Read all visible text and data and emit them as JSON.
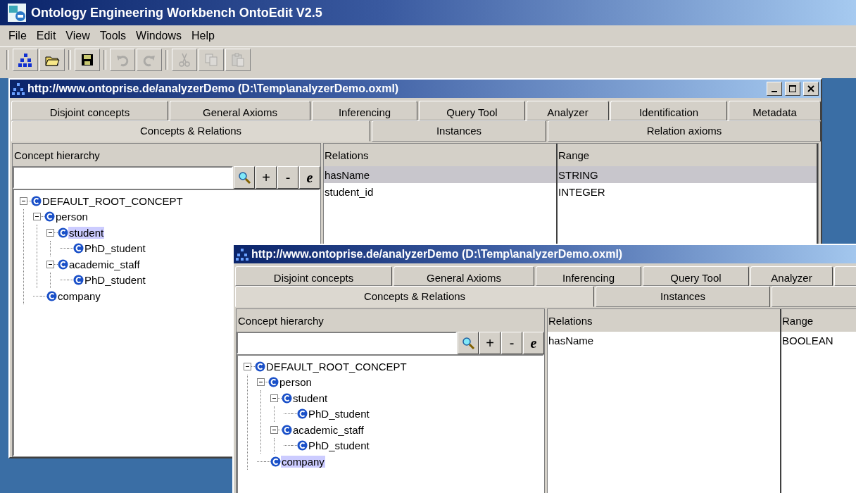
{
  "app": {
    "title": "Ontology Engineering Workbench OntoEdit V2.5",
    "menu": [
      "File",
      "Edit",
      "View",
      "Tools",
      "Windows",
      "Help"
    ],
    "toolbar": [
      {
        "kind": "hierarchy",
        "disabled": false
      },
      {
        "kind": "open",
        "disabled": false
      },
      {
        "kind": "save",
        "disabled": false
      },
      {
        "kind": "undo",
        "disabled": true
      },
      {
        "kind": "redo",
        "disabled": true
      },
      {
        "kind": "cut",
        "disabled": true
      },
      {
        "kind": "copy",
        "disabled": true
      },
      {
        "kind": "paste",
        "disabled": true
      }
    ]
  },
  "windows": [
    {
      "title": "http://www.ontoprise.de/analyzerDemo (D:\\Temp\\analyzerDemo.oxml)",
      "controls": true,
      "tabs_back": [
        {
          "label": "Disjoint concepts",
          "selected": false
        },
        {
          "label": "General Axioms",
          "selected": false
        },
        {
          "label": "Inferencing",
          "selected": false
        },
        {
          "label": "Query Tool",
          "selected": false
        },
        {
          "label": "Analyzer",
          "selected": false
        },
        {
          "label": "Identification",
          "selected": false
        },
        {
          "label": "Metadata",
          "selected": false
        }
      ],
      "tabs_front": [
        {
          "label": "Concepts & Relations",
          "selected": true
        },
        {
          "label": "Instances",
          "selected": false
        },
        {
          "label": "Relation axioms",
          "selected": false
        }
      ],
      "concept_panel": {
        "header": "Concept hierarchy",
        "buttons": [
          "+",
          "-",
          "e"
        ],
        "tree": [
          {
            "label": "DEFAULT_ROOT_CONCEPT",
            "selected": false,
            "expanded": true,
            "children": [
              {
                "label": "person",
                "selected": false,
                "expanded": true,
                "children": [
                  {
                    "label": "student",
                    "selected": true,
                    "expanded": true,
                    "children": [
                      {
                        "label": "PhD_student",
                        "selected": false
                      }
                    ]
                  },
                  {
                    "label": "academic_staff",
                    "selected": false,
                    "expanded": true,
                    "children": [
                      {
                        "label": "PhD_student",
                        "selected": false
                      }
                    ]
                  }
                ]
              },
              {
                "label": "company",
                "selected": false
              }
            ]
          }
        ]
      },
      "relations": {
        "columns": [
          "Relations",
          "Range"
        ],
        "rows": [
          {
            "relation": "hasName",
            "range": "STRING",
            "selected": true
          },
          {
            "relation": "student_id",
            "range": "INTEGER",
            "selected": false
          }
        ]
      }
    },
    {
      "title": "http://www.ontoprise.de/analyzerDemo (D:\\Temp\\analyzerDemo.oxml)",
      "controls": false,
      "tabs_back": [
        {
          "label": "Disjoint concepts",
          "selected": false
        },
        {
          "label": "General Axioms",
          "selected": false
        },
        {
          "label": "Inferencing",
          "selected": false
        },
        {
          "label": "Query Tool",
          "selected": false
        },
        {
          "label": "Analyzer",
          "selected": false
        }
      ],
      "tabs_front": [
        {
          "label": "Concepts & Relations",
          "selected": true
        },
        {
          "label": "Instances",
          "selected": false
        }
      ],
      "concept_panel": {
        "header": "Concept hierarchy",
        "buttons": [
          "+",
          "-",
          "e"
        ],
        "tree": [
          {
            "label": "DEFAULT_ROOT_CONCEPT",
            "selected": false,
            "expanded": true,
            "children": [
              {
                "label": "person",
                "selected": false,
                "expanded": true,
                "children": [
                  {
                    "label": "student",
                    "selected": false,
                    "expanded": true,
                    "children": [
                      {
                        "label": "PhD_student",
                        "selected": false
                      }
                    ]
                  },
                  {
                    "label": "academic_staff",
                    "selected": false,
                    "expanded": true,
                    "children": [
                      {
                        "label": "PhD_student",
                        "selected": false
                      }
                    ]
                  }
                ]
              },
              {
                "label": "company",
                "selected": true
              }
            ]
          }
        ]
      },
      "relations": {
        "columns": [
          "Relations",
          "Range"
        ],
        "rows": [
          {
            "relation": "hasName",
            "range": "BOOLEAN",
            "selected": false
          }
        ]
      }
    }
  ]
}
